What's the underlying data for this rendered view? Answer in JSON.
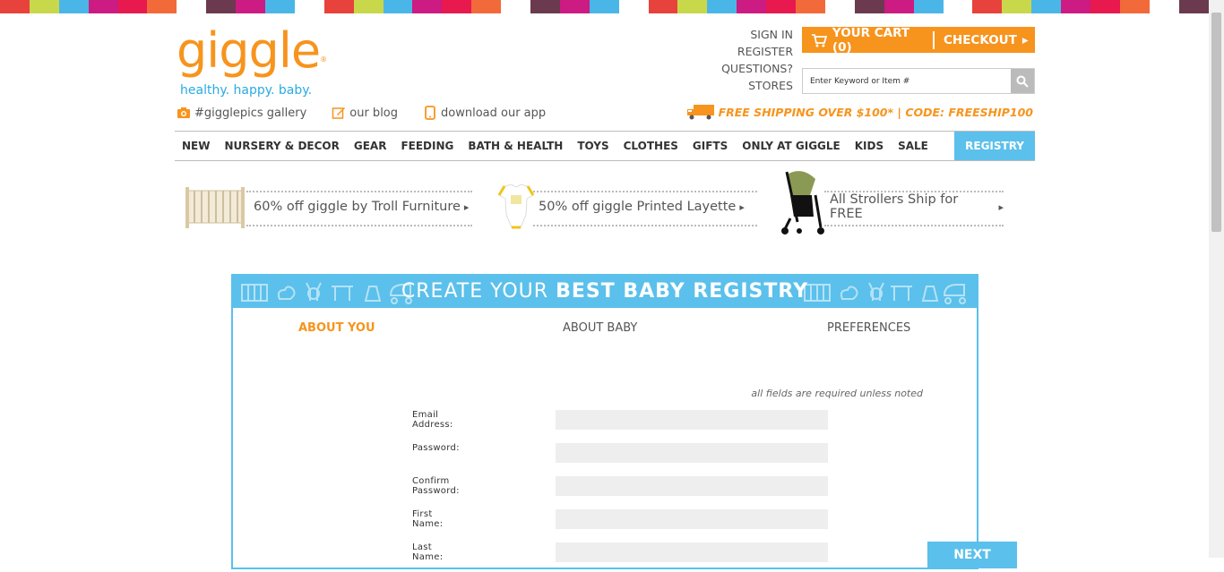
{
  "stripe_colors": [
    "#e8423c",
    "#c9d84a",
    "#4ab6e8",
    "#cc1b82",
    "#e8194f",
    "#f26a3a",
    "#ffffff",
    "#6b3a4e",
    "#cc1b82",
    "#4ab6e8",
    "#ffffff",
    "#e8423c",
    "#c9d84a",
    "#4ab6e8",
    "#cc1b82",
    "#e8194f",
    "#f26a3a",
    "#ffffff",
    "#6b3a4e",
    "#cc1b82",
    "#4ab6e8",
    "#ffffff",
    "#e8423c",
    "#c9d84a",
    "#4ab6e8",
    "#cc1b82",
    "#e8194f",
    "#f26a3a",
    "#ffffff",
    "#6b3a4e",
    "#cc1b82",
    "#4ab6e8",
    "#ffffff",
    "#e8423c",
    "#c9d84a",
    "#4ab6e8",
    "#cc1b82",
    "#e8194f",
    "#f26a3a",
    "#ffffff",
    "#6b3a4e"
  ],
  "brand": {
    "logo": "giggle",
    "tagline": "healthy. happy. baby.",
    "accent": "#f7941d",
    "blue": "#5bc0eb"
  },
  "sublinks": [
    {
      "icon": "camera-icon",
      "label": "#gigglepics gallery"
    },
    {
      "icon": "pencil-icon",
      "label": "our blog"
    },
    {
      "icon": "phone-icon",
      "label": "download our app"
    }
  ],
  "account": {
    "sign_in": "SIGN IN",
    "register": "REGISTER",
    "questions": "QUESTIONS?",
    "stores": "STORES"
  },
  "cart": {
    "label": "YOUR CART (0)",
    "checkout": "CHECKOUT"
  },
  "search": {
    "placeholder": "Enter Keyword or Item #"
  },
  "shipping": "FREE SHIPPING OVER $100* | CODE: FREESHIP100",
  "nav": [
    "NEW",
    "NURSERY & DECOR",
    "GEAR",
    "FEEDING",
    "BATH & HEALTH",
    "TOYS",
    "CLOTHES",
    "GIFTS",
    "ONLY AT GIGGLE",
    "KIDS",
    "SALE",
    "REGISTRY"
  ],
  "promos": [
    {
      "label": "60% off giggle by Troll Furniture"
    },
    {
      "label": "50% off giggle Printed Layette"
    },
    {
      "label": "All Strollers Ship for FREE"
    }
  ],
  "registry": {
    "title_light": "CREATE YOUR",
    "title_bold": "BEST BABY REGISTRY",
    "steps": [
      "ABOUT YOU",
      "ABOUT BABY",
      "PREFERENCES"
    ],
    "note": "all fields are required unless noted",
    "fields": [
      "Email Address:",
      "Password:",
      "Confirm Password:",
      "First Name:",
      "Last Name:"
    ],
    "next": "NEXT"
  }
}
